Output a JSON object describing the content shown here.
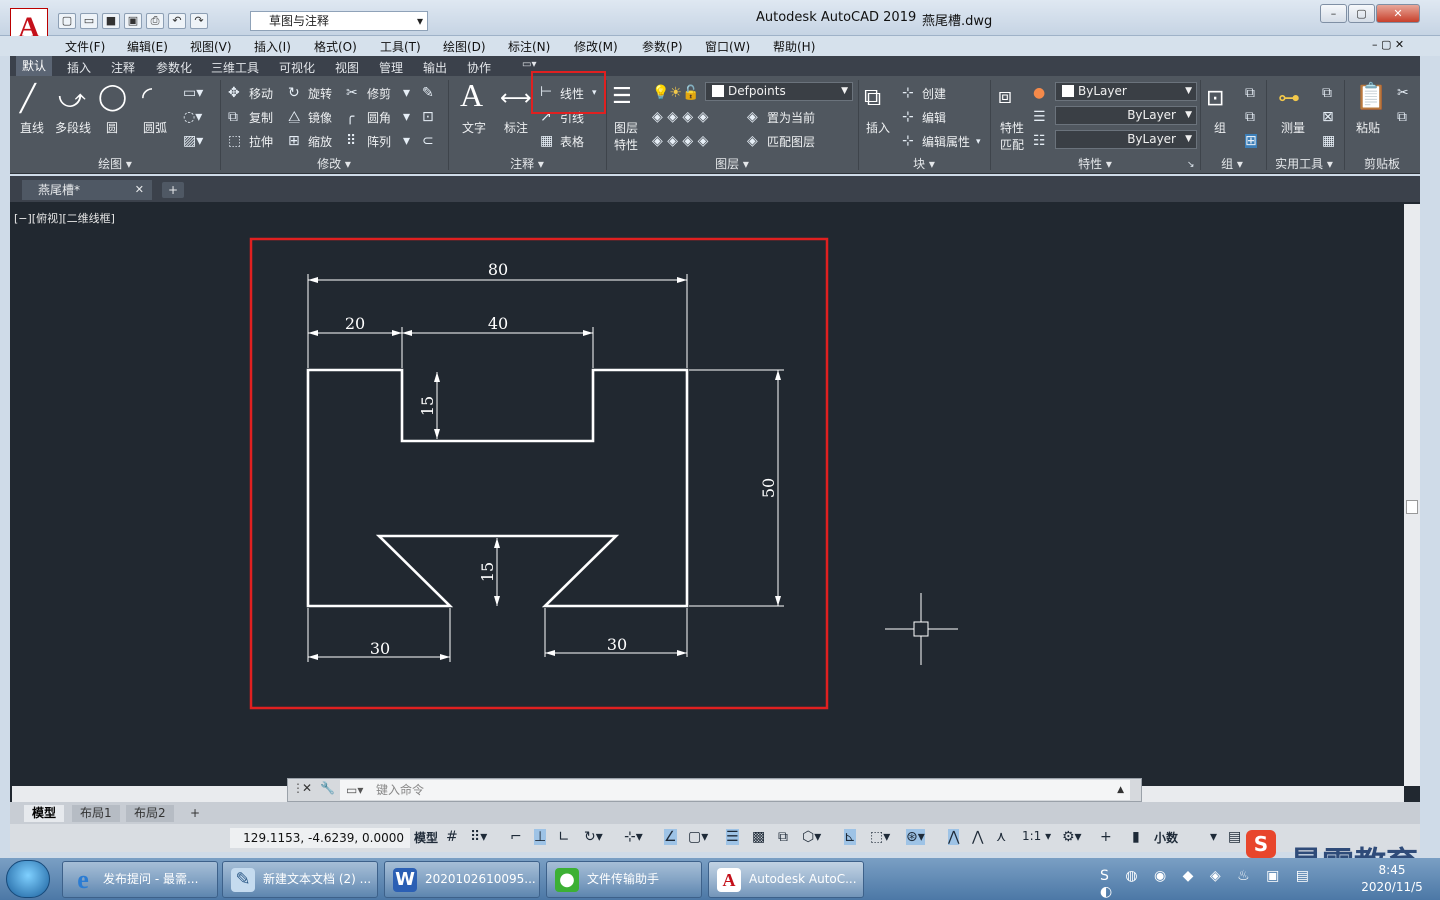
{
  "window": {
    "app_title": "Autodesk AutoCAD 2019",
    "file_name": "燕尾槽.dwg",
    "workspace": "草图与注释"
  },
  "menubar": [
    "文件(F)",
    "编辑(E)",
    "视图(V)",
    "插入(I)",
    "格式(O)",
    "工具(T)",
    "绘图(D)",
    "标注(N)",
    "修改(M)",
    "参数(P)",
    "窗口(W)",
    "帮助(H)"
  ],
  "ribbon_tabs": [
    "默认",
    "插入",
    "注释",
    "参数化",
    "三维工具",
    "可视化",
    "视图",
    "管理",
    "输出",
    "协作"
  ],
  "ribbon": {
    "draw": {
      "line": "直线",
      "polyline": "多段线",
      "circle": "圆",
      "arc": "圆弧",
      "title": "绘图"
    },
    "modify": {
      "move": "移动",
      "rotate": "旋转",
      "trim": "修剪",
      "copy": "复制",
      "mirror": "镜像",
      "fillet": "圆角",
      "stretch": "拉伸",
      "scale": "缩放",
      "array": "阵列",
      "title": "修改"
    },
    "annotation": {
      "text": "文字",
      "dimension": "标注",
      "linear": "线性",
      "leader": "引线",
      "table": "表格",
      "title": "注释"
    },
    "layers": {
      "layer_props_1": "图层",
      "layer_props_2": "特性",
      "current_layer": "Defpoints",
      "set_current": "置为当前",
      "match_layer": "匹配图层",
      "title": "图层"
    },
    "block": {
      "insert": "插入",
      "create": "创建",
      "edit": "编辑",
      "edit_attr": "编辑属性",
      "title": "块"
    },
    "properties": {
      "match_1": "特性",
      "match_2": "匹配",
      "color": "ByLayer",
      "linetype": "ByLayer",
      "lineweight": "ByLayer",
      "title": "特性"
    },
    "groups": {
      "group": "组",
      "title": "组"
    },
    "utilities": {
      "measure": "测量",
      "title": "实用工具"
    },
    "clipboard": {
      "paste": "粘贴",
      "title": "剪贴板"
    }
  },
  "file_tab": "燕尾槽*",
  "viewport_label": "[−][俯视][二维线框]",
  "drawing": {
    "dimensions": [
      "80",
      "20",
      "40",
      "15",
      "50",
      "15",
      "30",
      "30"
    ]
  },
  "command_line": {
    "placeholder": "键入命令"
  },
  "layout_tabs": [
    "模型",
    "布局1",
    "布局2"
  ],
  "status": {
    "coordinates": "129.1153, -4.6239, 0.0000",
    "model": "模型",
    "scale": "1:1",
    "units": "小数"
  },
  "taskbar": {
    "items": [
      "发布提问 - 最需...",
      "新建文本文档 (2) ...",
      "2020102610095...",
      "文件传输助手",
      "Autodesk AutoC..."
    ],
    "time": "8:45",
    "date": "2020/11/5"
  },
  "watermark": "最需教育",
  "colors": {
    "canvas": "#212830",
    "highlight": "#e02020",
    "ribbon": "#50575f"
  }
}
